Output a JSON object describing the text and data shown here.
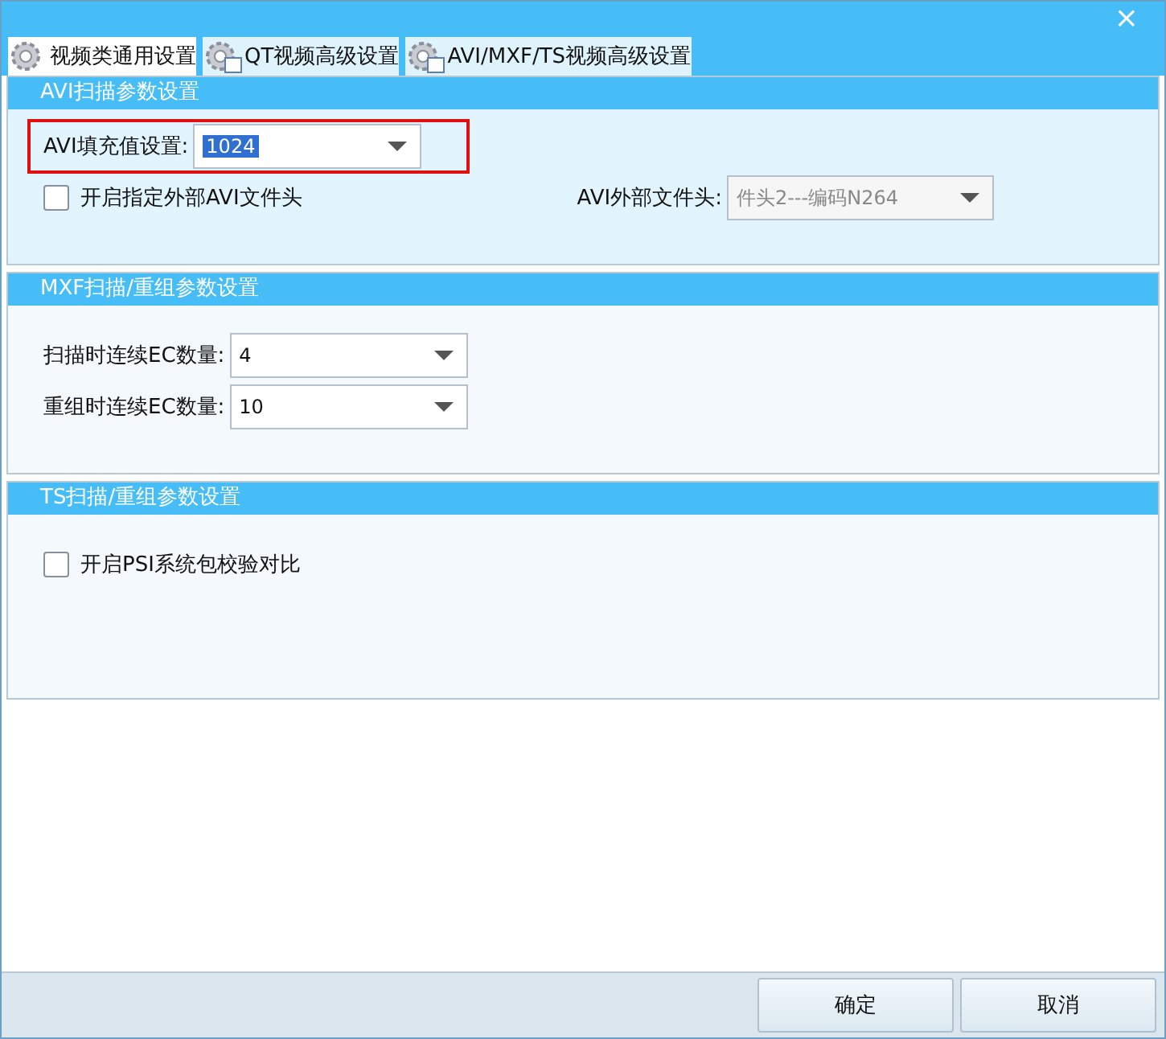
{
  "window": {
    "close": "×"
  },
  "tabs": [
    {
      "label": "视频类通用设置",
      "selected": true
    },
    {
      "label": "QT视频高级设置",
      "selected": false
    },
    {
      "label": "AVI/MXF/TS视频高级设置",
      "selected": false
    }
  ],
  "groups": [
    {
      "title": "AVI扫描参数设置",
      "rows": [
        {
          "kind": "combo",
          "label": "AVI填充值设置:",
          "value": "1024",
          "value_selected": true,
          "highlighted": true,
          "disabled": false
        },
        {
          "kind": "check_combo",
          "label": "开启指定外部AVI文件头",
          "checked": false,
          "combo_label": "AVI外部文件头:",
          "value": "件头2---编码N264",
          "disabled": true
        }
      ]
    },
    {
      "title": "MXF扫描/重组参数设置",
      "rows": [
        {
          "kind": "combo",
          "label": "扫描时连续EC数量:",
          "value": "4",
          "value_selected": false,
          "highlighted": false,
          "disabled": false
        },
        {
          "kind": "combo",
          "label": "重组时连续EC数量:",
          "value": "10",
          "value_selected": false,
          "highlighted": false,
          "disabled": false
        }
      ]
    },
    {
      "title": "TS扫描/重组参数设置",
      "rows": [
        {
          "kind": "check",
          "label": "开启PSI系统包校验对比",
          "checked": false
        }
      ]
    }
  ],
  "buttons": [
    "确定",
    "取消"
  ]
}
